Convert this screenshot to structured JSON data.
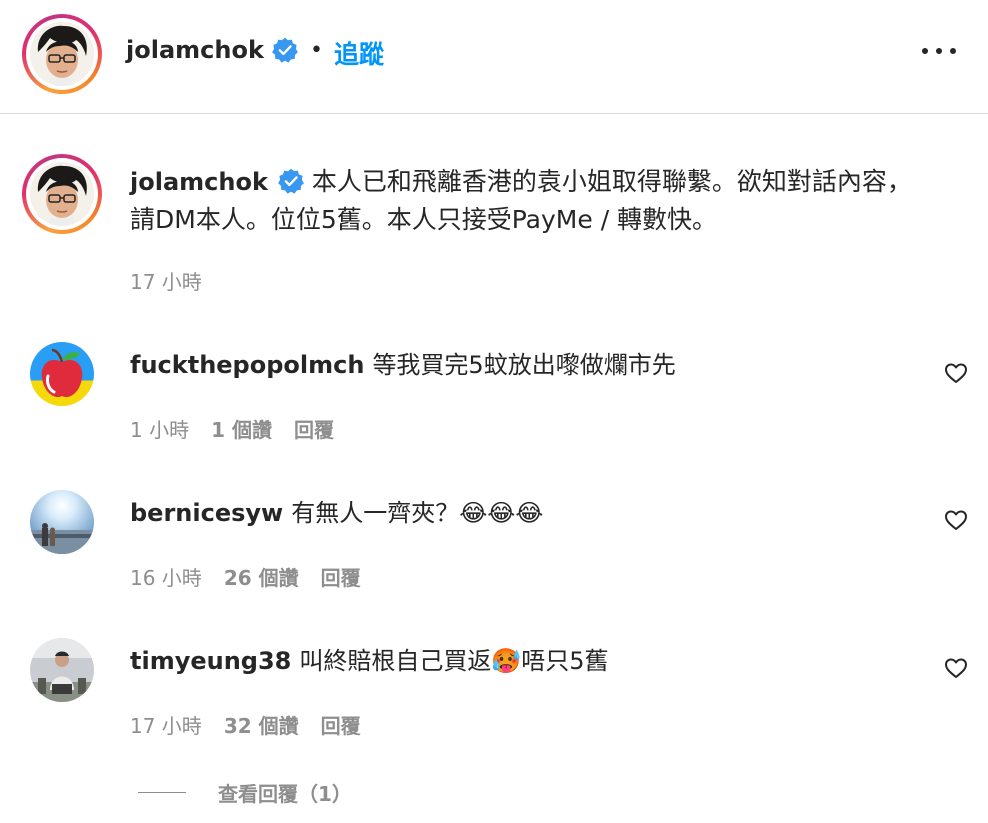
{
  "header": {
    "username": "jolamchok",
    "dot": "•",
    "follow_label": "追蹤"
  },
  "caption": {
    "username": "jolamchok",
    "text": "本人已和飛離香港的袁小姐取得聯繫。欲知對話內容，請DM本人。位位5舊。本人只接受PayMe / 轉數快。",
    "time": "17 小時"
  },
  "comments": [
    {
      "username": "fuckthepopolmch",
      "text": "等我買完5蚊放出嚟做爛市先",
      "time": "1 小時",
      "likes": "1 個讚",
      "reply_label": "回覆"
    },
    {
      "username": "bernicesyw",
      "text": "有無人一齊夾？😂😂😂",
      "time": "16 小時",
      "likes": "26 個讚",
      "reply_label": "回覆"
    },
    {
      "username": "timyeung38",
      "text": "叫終賠根自己買返🥵唔只5舊",
      "time": "17 小時",
      "likes": "32 個讚",
      "reply_label": "回覆"
    }
  ],
  "view_replies_label": "查看回覆（1）",
  "colors": {
    "link_blue": "#0095f6",
    "verified_blue": "#3897f0",
    "secondary_text": "#8e8e8e",
    "primary_text": "#262626"
  },
  "icons": {
    "verified": "verified-badge-icon",
    "more": "more-options-icon",
    "like": "heart-icon"
  }
}
